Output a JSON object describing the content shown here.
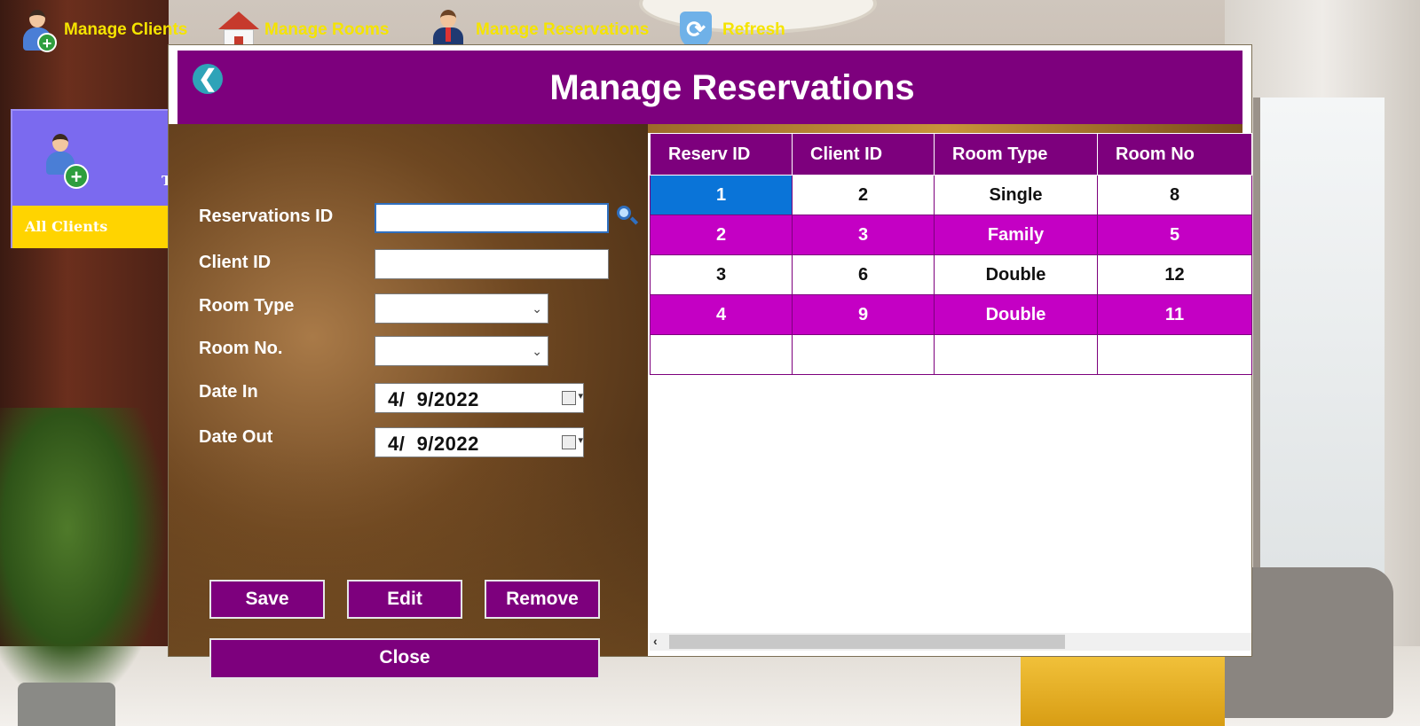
{
  "topbar": {
    "items": [
      {
        "label": "Manage Clients",
        "icon": "add-client-icon"
      },
      {
        "label": "Manage Rooms",
        "icon": "house-icon"
      },
      {
        "label": "Manage Reservations",
        "icon": "businessman-icon"
      },
      {
        "label": "Refresh",
        "icon": "refresh-icon"
      }
    ]
  },
  "left_panel": {
    "letter": "T",
    "bottom_label": "All Clients"
  },
  "window": {
    "title": "Manage Reservations",
    "back_symbol": "❮"
  },
  "form": {
    "reservation_id_label": "Reservations ID",
    "reservation_id_value": "",
    "client_id_label": "Client ID",
    "client_id_value": "",
    "room_type_label": "Room Type",
    "room_type_value": "",
    "room_no_label": "Room No.",
    "room_no_value": "",
    "date_in_label": "Date In",
    "date_in_value": "4/  9/2022",
    "date_out_label": "Date Out",
    "date_out_value": "4/  9/2022"
  },
  "buttons": {
    "save": "Save",
    "edit": "Edit",
    "remove": "Remove",
    "close": "Close"
  },
  "grid": {
    "columns": [
      "Reserv ID",
      "Client ID",
      "Room Type",
      "Room No"
    ],
    "rows": [
      [
        "1",
        "2",
        "Single",
        "8"
      ],
      [
        "2",
        "3",
        "Family",
        "5"
      ],
      [
        "3",
        "6",
        "Double",
        "12"
      ],
      [
        "4",
        "9",
        "Double",
        "11"
      ]
    ],
    "selected_row": 0
  },
  "colors": {
    "header_purple": "#7d007d",
    "alt_row_magenta": "#c400c4",
    "menu_text_yellow": "#f5e400",
    "selection_blue": "#0a74d8"
  }
}
